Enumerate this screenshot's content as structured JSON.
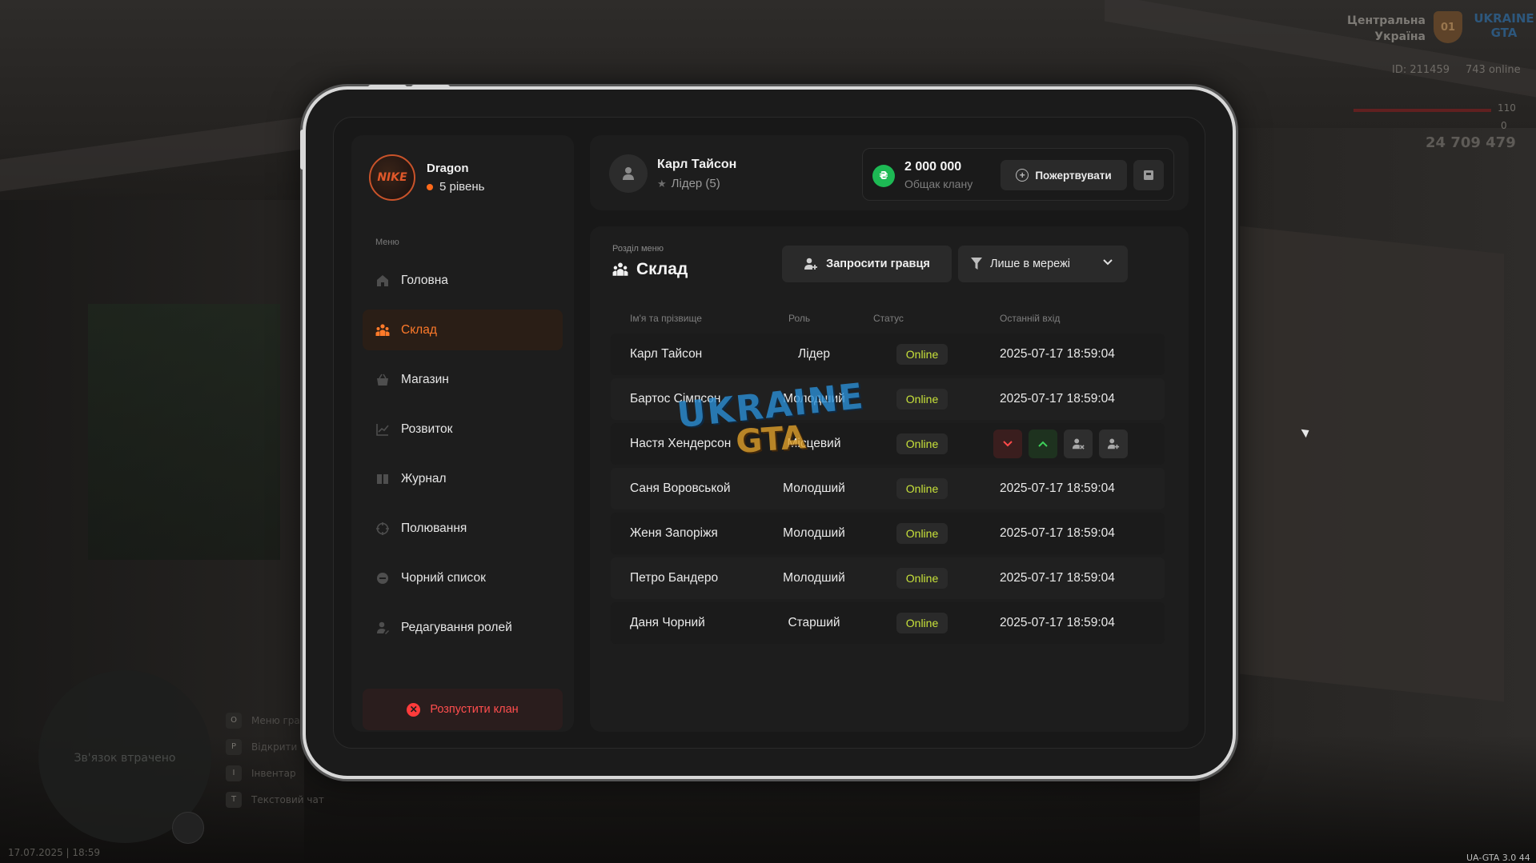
{
  "hud": {
    "city_line1": "Центральна",
    "city_line2": "Україна",
    "region_badge": "01",
    "logo_line1": "UKRAINE",
    "logo_line2": "GTA",
    "player_id": "ID: 211459",
    "online": "743 online",
    "health": "110",
    "armor": "0",
    "money": "24 709 479",
    "minimap_text": "Зв'язок втрачено",
    "hints": [
      {
        "key": "O",
        "label": "Меню гра"
      },
      {
        "key": "P",
        "label": "Відкрити"
      },
      {
        "key": "I",
        "label": "Інвентар"
      },
      {
        "key": "T",
        "label": "Текстовий чат"
      }
    ],
    "datetime": "17.07.2025 | 18:59",
    "version": "UA-GTA 3.0",
    "version_extra": "44"
  },
  "clan": {
    "logo_text": "NIKE",
    "name": "Dragon",
    "level": "5 рівень"
  },
  "menu": {
    "caption": "Меню",
    "items": [
      {
        "label": "Головна",
        "icon": "home-icon"
      },
      {
        "label": "Склад",
        "icon": "members-icon",
        "active": true
      },
      {
        "label": "Магазин",
        "icon": "shop-icon"
      },
      {
        "label": "Розвиток",
        "icon": "chart-icon"
      },
      {
        "label": "Журнал",
        "icon": "book-icon"
      },
      {
        "label": "Полювання",
        "icon": "target-icon"
      },
      {
        "label": "Чорний список",
        "icon": "block-icon"
      },
      {
        "label": "Редагування ролей",
        "icon": "user-edit-icon"
      }
    ],
    "disband_label": "Розпустити клан"
  },
  "user": {
    "name": "Карл Тайсон",
    "role": "Лідер (5)"
  },
  "bank": {
    "currency_symbol": "₴",
    "amount": "2 000 000",
    "caption": "Общак клану",
    "donate_label": "Пожертвувати"
  },
  "section": {
    "caption": "Розділ меню",
    "title": "Склад",
    "invite_label": "Запросити гравця",
    "filter_value": "Лише в мережі"
  },
  "table": {
    "headers": {
      "name": "Ім'я та прізвище",
      "role": "Роль",
      "status": "Статус",
      "last": "Останній вхід"
    },
    "rows": [
      {
        "name": "Карл Тайсон",
        "role": "Лідер",
        "status": "Online",
        "last": "2025-07-17 18:59:04"
      },
      {
        "name": "Бартос Сімпсон",
        "role": "Молодший",
        "status": "Online",
        "last": "2025-07-17 18:59:04"
      },
      {
        "name": "Настя Хендерсон",
        "role": "Місцевий",
        "status": "Online",
        "last": ""
      },
      {
        "name": "Саня Воровськой",
        "role": "Молодший",
        "status": "Online",
        "last": "2025-07-17 18:59:04"
      },
      {
        "name": "Женя Запоріжя",
        "role": "Молодший",
        "status": "Online",
        "last": "2025-07-17 18:59:04"
      },
      {
        "name": "Петро Бандеро",
        "role": "Молодший",
        "status": "Online",
        "last": "2025-07-17 18:59:04"
      },
      {
        "name": "Даня Чорний",
        "role": "Старший",
        "status": "Online",
        "last": "2025-07-17 18:59:04"
      }
    ]
  },
  "watermark": {
    "line1": "UKRAINE",
    "line2": "GTA"
  },
  "colors": {
    "accent": "#ff7a2a",
    "online": "#c8e23a",
    "danger": "#ff3b3b",
    "money": "#1db954"
  }
}
